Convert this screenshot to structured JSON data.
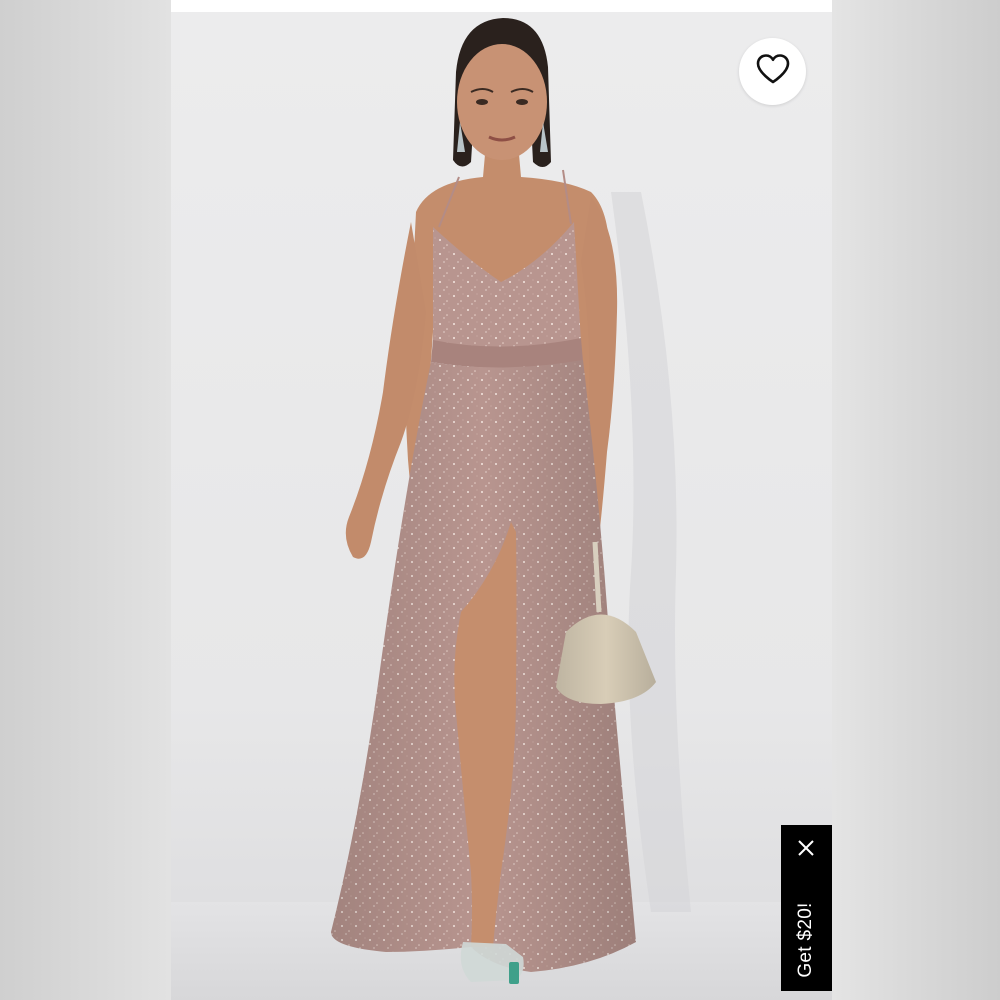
{
  "image": {
    "description_icon": "product-photo"
  },
  "favorite": {
    "icon": "heart-outline-icon",
    "color": "#111111"
  },
  "promo": {
    "label": "Get $20!",
    "close_icon": "close-icon",
    "background": "#000000",
    "text_color": "#ffffff"
  },
  "colors": {
    "dress": "#b8958f",
    "backdrop": "#ececed"
  }
}
